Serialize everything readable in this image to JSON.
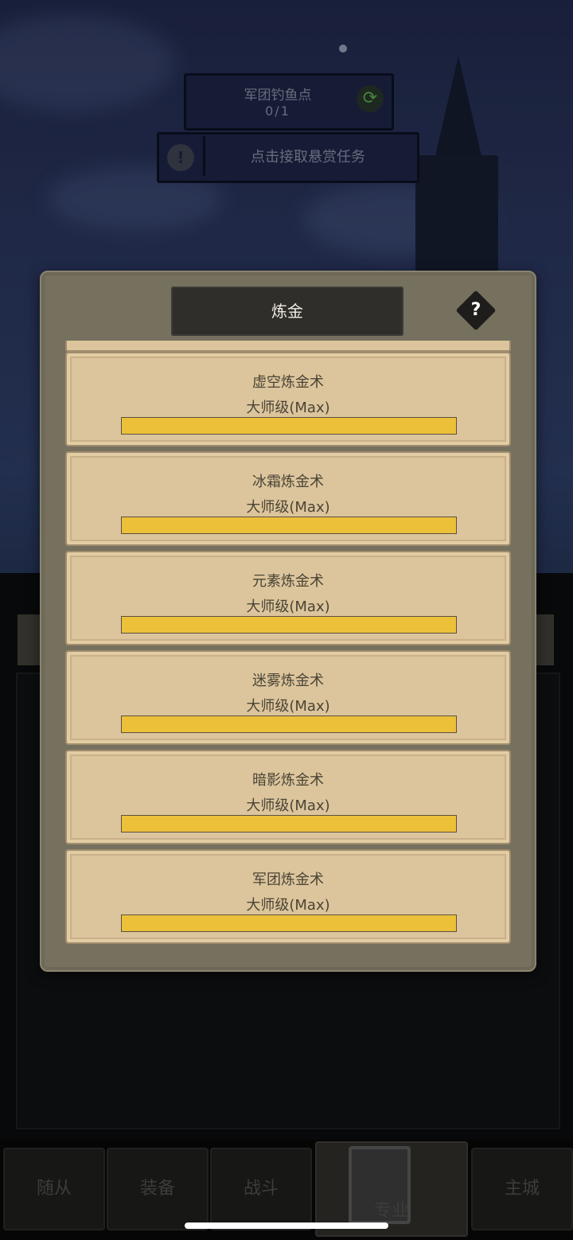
{
  "hud": {
    "fishing_title": "军团钓鱼点",
    "fishing_count": "0/1",
    "quest_text": "点击接取悬赏任务"
  },
  "modal": {
    "title": "炼金",
    "help_label": "?"
  },
  "skills": [
    {
      "name": "虚空炼金术",
      "level": "大师级(Max)",
      "progress": 1.0
    },
    {
      "name": "冰霜炼金术",
      "level": "大师级(Max)",
      "progress": 1.0
    },
    {
      "name": "元素炼金术",
      "level": "大师级(Max)",
      "progress": 1.0
    },
    {
      "name": "迷雾炼金术",
      "level": "大师级(Max)",
      "progress": 1.0
    },
    {
      "name": "暗影炼金术",
      "level": "大师级(Max)",
      "progress": 1.0
    },
    {
      "name": "军团炼金术",
      "level": "大师级(Max)",
      "progress": 1.0
    }
  ],
  "bottom_nav": [
    {
      "label": "随从"
    },
    {
      "label": "装备"
    },
    {
      "label": "战斗"
    },
    {
      "label": "专业",
      "active": true
    },
    {
      "label": "主城"
    }
  ],
  "colors": {
    "progress_fill": "#edc03a",
    "card_bg": "#dcc59c",
    "modal_bg": "#76705f"
  }
}
